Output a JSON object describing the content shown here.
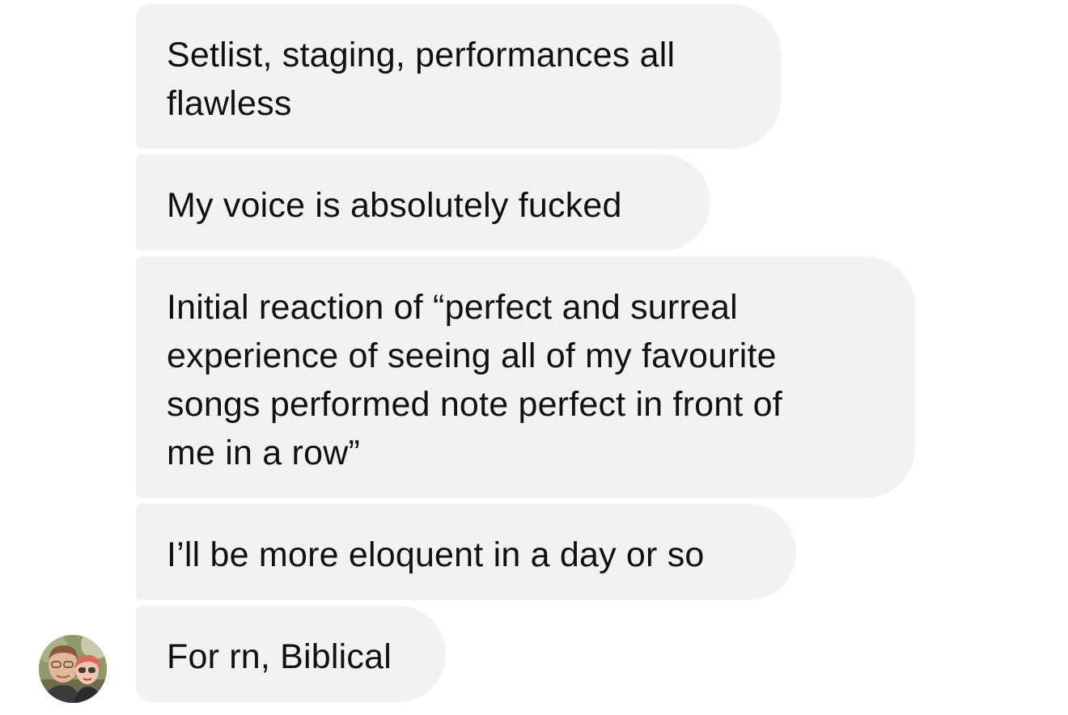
{
  "conversation": {
    "messages": [
      {
        "text": "Setlist, staging, performances all\nflawless"
      },
      {
        "text": "My voice is absolutely fucked"
      },
      {
        "text": "Initial reaction of “perfect and surreal\nexperience of seeing all of my favourite\nsongs performed note perfect in front of\nme in a row”"
      },
      {
        "text": "I’ll be more eloquent in a day or so"
      },
      {
        "text": "For rn, Biblical"
      }
    ],
    "avatar_icon": "sender-avatar-photo"
  },
  "colors": {
    "bubble_background": "#f1f2f4",
    "text": "#111111",
    "page_background": "#ffffff"
  }
}
